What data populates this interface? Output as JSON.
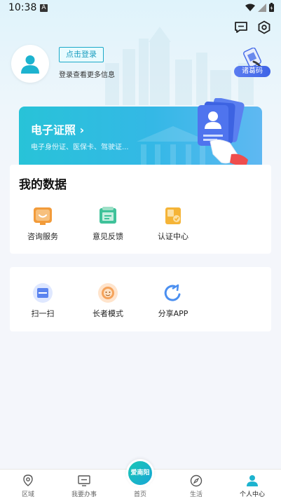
{
  "status_bar": {
    "time": "10:38",
    "notification_badge": "A"
  },
  "header": {
    "message_icon": "message-icon",
    "settings_icon": "settings-icon"
  },
  "profile": {
    "login_label": "点击登录",
    "login_hint": "登录查看更多信息",
    "code_label": "诸葛码"
  },
  "cert_banner": {
    "title": "电子证照 ›",
    "subtitle": "电子身份证、医保卡、驾驶证..."
  },
  "my_data": {
    "title": "我的数据",
    "items": [
      {
        "label": "咨询服务",
        "icon": "consult-icon",
        "color": "#f29b3a"
      },
      {
        "label": "意见反馈",
        "icon": "feedback-icon",
        "color": "#3fc29a"
      },
      {
        "label": "认证中心",
        "icon": "auth-icon",
        "color": "#f5b437"
      }
    ]
  },
  "tools": {
    "items": [
      {
        "label": "扫一扫",
        "icon": "scan-icon",
        "color": "#5b84ef"
      },
      {
        "label": "长者模式",
        "icon": "elder-icon",
        "color": "#f5a35b"
      },
      {
        "label": "分享APP",
        "icon": "share-icon",
        "color": "#4b8ff0"
      }
    ]
  },
  "bottom_nav": {
    "items": [
      {
        "label": "区域",
        "icon": "location-icon"
      },
      {
        "label": "我要办事",
        "icon": "monitor-icon"
      },
      {
        "label": "首页",
        "icon": "home-icon"
      },
      {
        "label": "生活",
        "icon": "compass-icon"
      },
      {
        "label": "个人中心",
        "icon": "person-icon"
      }
    ],
    "home_bubble_text": "爱南阳"
  },
  "colors": {
    "accent": "#1ba9c8",
    "banner": "#34b8e6",
    "code_badge": "#4a6fe8"
  }
}
